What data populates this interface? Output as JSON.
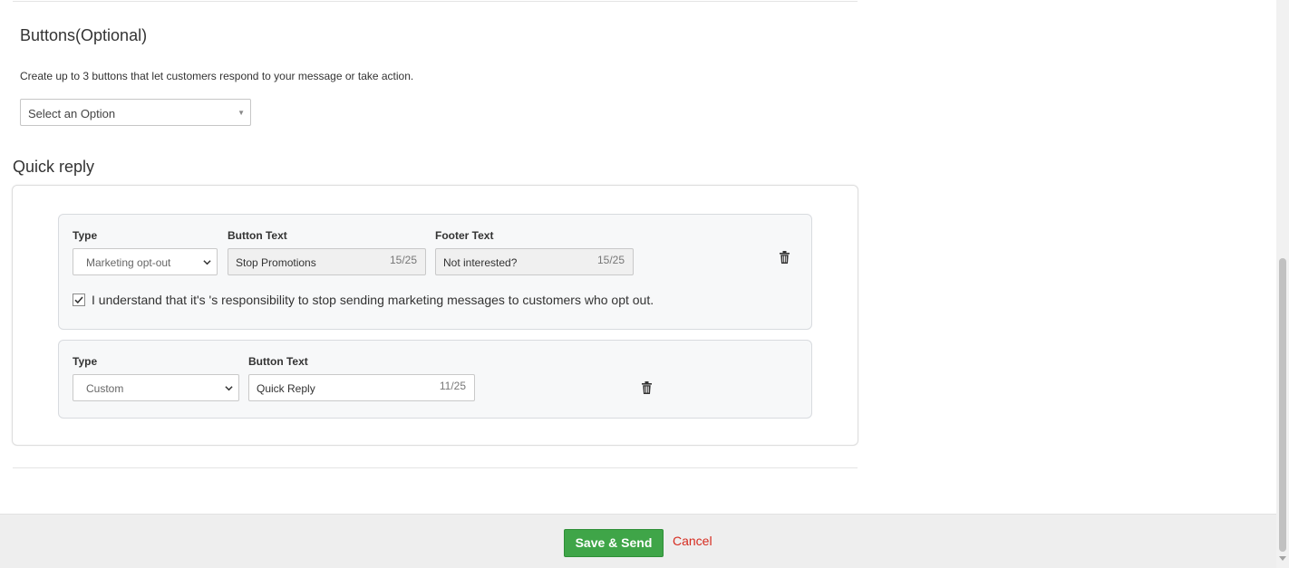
{
  "buttons_section": {
    "title": "Buttons(Optional)",
    "description": "Create up to 3 buttons that let customers respond to your message or take action.",
    "select_value": "Select an Option"
  },
  "quick_reply": {
    "title": "Quick reply",
    "cards": [
      {
        "type_label": "Type",
        "type_value": "Marketing opt-out",
        "button_text_label": "Button Text",
        "button_text_value": "Stop Promotions",
        "button_text_count": "15/25",
        "footer_text_label": "Footer Text",
        "footer_text_value": "Not interested?",
        "footer_text_count": "15/25",
        "consent_checked": true,
        "consent_text": "I understand that it's 's responsibility to stop sending marketing messages to customers who opt out."
      },
      {
        "type_label": "Type",
        "type_value": "Custom",
        "button_text_label": "Button Text",
        "button_text_value": "Quick Reply",
        "button_text_count": "11/25"
      }
    ]
  },
  "footer": {
    "save_label": "Save & Send",
    "cancel_label": "Cancel"
  },
  "colors": {
    "save_green": "#3fa548",
    "cancel_red": "#d62b1f",
    "card_bg": "#f7f8f9"
  }
}
